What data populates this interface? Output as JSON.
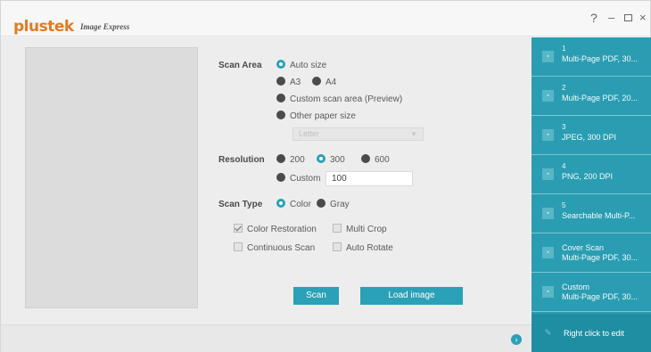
{
  "title_bar": {
    "brand": "plustek",
    "app_name": "Image Express",
    "help_glyph": "?",
    "minimize_glyph": "–",
    "close_glyph": "×"
  },
  "scan_area": {
    "label": "Scan Area",
    "options": [
      "Auto size",
      "A3",
      "A4",
      "Custom scan area (Preview)",
      "Other paper size"
    ],
    "selected": "Auto size",
    "paper_size_dropdown": {
      "value": "Letter"
    }
  },
  "resolution": {
    "label": "Resolution",
    "options": [
      "200",
      "300",
      "600",
      "Custom"
    ],
    "selected": "300",
    "custom_value": "100"
  },
  "scan_type": {
    "label": "Scan Type",
    "options": [
      "Color",
      "Gray"
    ],
    "selected": "Color"
  },
  "checkboxes": [
    {
      "label": "Color Restoration",
      "checked": true
    },
    {
      "label": "Multi Crop",
      "checked": false
    },
    {
      "label": "Continuous Scan",
      "checked": false
    },
    {
      "label": "Auto Rotate",
      "checked": false
    }
  ],
  "buttons": {
    "scan": "Scan",
    "load_image": "Load image"
  },
  "jobs": [
    {
      "number": "1",
      "name": "Multi-Page PDF, 30..."
    },
    {
      "number": "2",
      "name": "Multi-Page PDF, 20..."
    },
    {
      "number": "3",
      "name": "JPEG, 300 DPI"
    },
    {
      "number": "4",
      "name": "PNG, 200 DPI"
    },
    {
      "number": "5",
      "name": "Searchable Multi-P..."
    },
    {
      "number": "",
      "name": "Cover Scan",
      "detail": "Multi-Page PDF, 30..."
    },
    {
      "number": "",
      "name": "Custom",
      "detail": "Multi-Page PDF, 30..."
    }
  ],
  "edit_hint": "Right click to edit",
  "colors": {
    "accent": "#2aa1b6",
    "brand": "#e07b22",
    "panel": "#2b9db2"
  }
}
